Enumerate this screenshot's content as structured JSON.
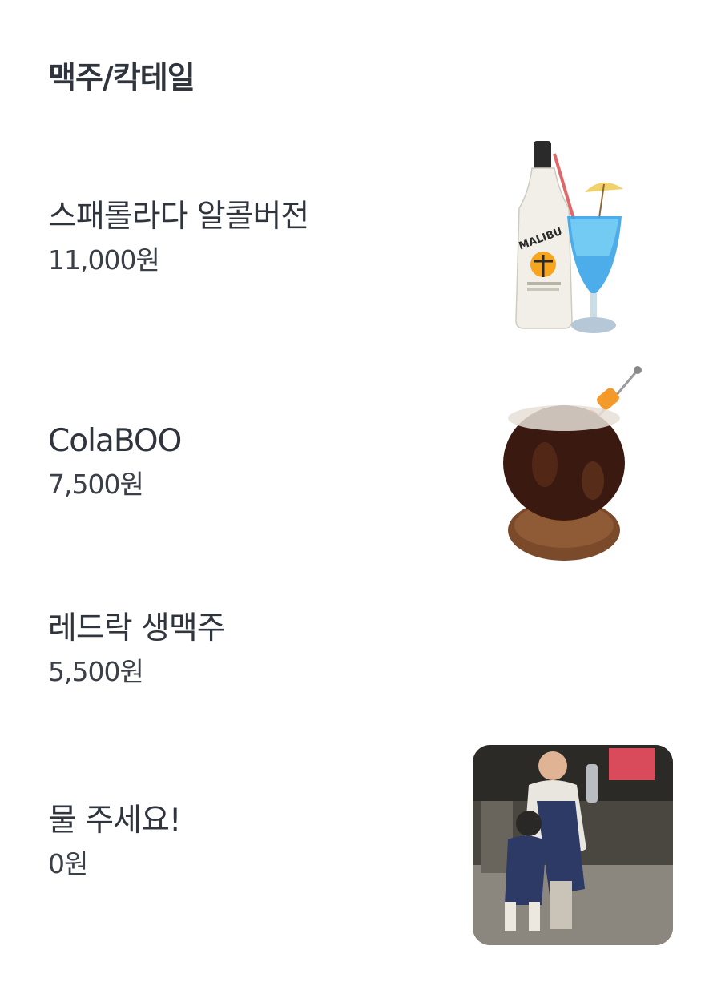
{
  "category": {
    "title": "맥주/칵테일"
  },
  "items": [
    {
      "name": "스패롤라다 알콜버전",
      "price": "11,000원",
      "image": "cocktail-bottle-glass"
    },
    {
      "name": "ColaBOO",
      "price": "7,500원",
      "image": "cola-glass"
    },
    {
      "name": "레드락 생맥주",
      "price": "5,500원",
      "image": ""
    },
    {
      "name": "물 주세요!",
      "price": "0원",
      "image": "staff-photo"
    }
  ],
  "bottle_label": "MALIBU",
  "colors": {
    "text": "#2f343d",
    "blue_cocktail": "#3aa3e8",
    "cola": "#3a1a10"
  }
}
